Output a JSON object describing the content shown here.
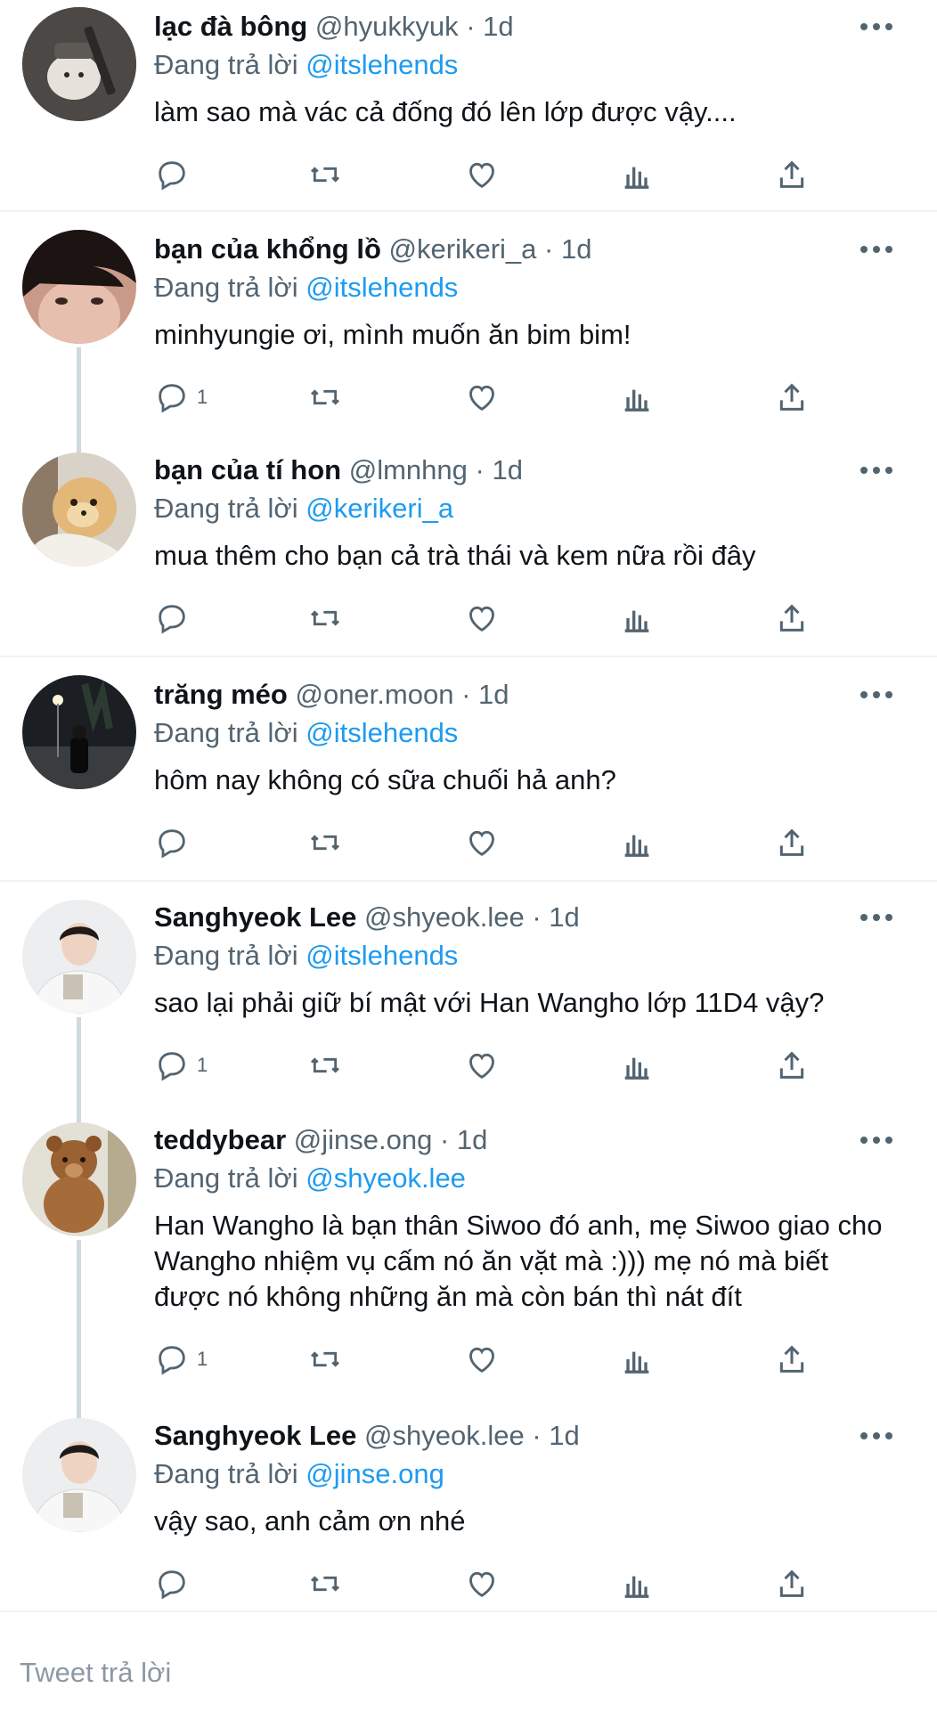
{
  "colors": {
    "accent": "#1d9bf0",
    "muted": "#536471",
    "text": "#0f1419"
  },
  "icons": {
    "reply": "reply-icon",
    "retweet": "retweet-icon",
    "like": "heart-icon",
    "views": "analytics-icon",
    "share": "share-icon",
    "more": "more-dots-icon"
  },
  "reply_prefix": "Đang trả lời",
  "tweets": [
    {
      "name": "lạc đà bông",
      "handle": "@hyukkyuk",
      "time": "1d",
      "reply_to": "@itslehends",
      "text": "làm sao mà vác cả đống đó lên lớp được vậy....",
      "reply_count": ""
    },
    {
      "name": "bạn của khổng lồ",
      "handle": "@kerikeri_a",
      "time": "1d",
      "reply_to": "@itslehends",
      "text": "minhyungie ơi, mình muốn ăn bim bim!",
      "reply_count": "1"
    },
    {
      "name": "bạn của tí hon",
      "handle": "@lmnhng",
      "time": "1d",
      "reply_to": "@kerikeri_a",
      "text": "mua thêm cho bạn cả trà thái và kem nữa rồi đây",
      "reply_count": ""
    },
    {
      "name": "trăng méo",
      "handle": "@oner.moon",
      "time": "1d",
      "reply_to": "@itslehends",
      "text": "hôm nay không có sữa chuối hả anh?",
      "reply_count": ""
    },
    {
      "name": "Sanghyeok Lee",
      "handle": "@shyeok.lee",
      "time": "1d",
      "reply_to": "@itslehends",
      "text": "sao lại phải giữ bí mật với Han Wangho lớp 11D4 vậy?",
      "reply_count": "1"
    },
    {
      "name": "teddybear",
      "handle": "@jinse.ong",
      "time": "1d",
      "reply_to": "@shyeok.lee",
      "text": "Han Wangho là bạn thân Siwoo đó anh, mẹ Siwoo giao cho Wangho nhiệm vụ cấm nó ăn vặt mà :))) mẹ nó mà biết được nó không những ăn mà còn bán thì nát đít",
      "reply_count": "1"
    },
    {
      "name": "Sanghyeok Lee",
      "handle": "@shyeok.lee",
      "time": "1d",
      "reply_to": "@jinse.ong",
      "text": "vậy sao, anh cảm ơn nhé",
      "reply_count": ""
    }
  ],
  "composer": {
    "placeholder": "Tweet trả lời"
  }
}
